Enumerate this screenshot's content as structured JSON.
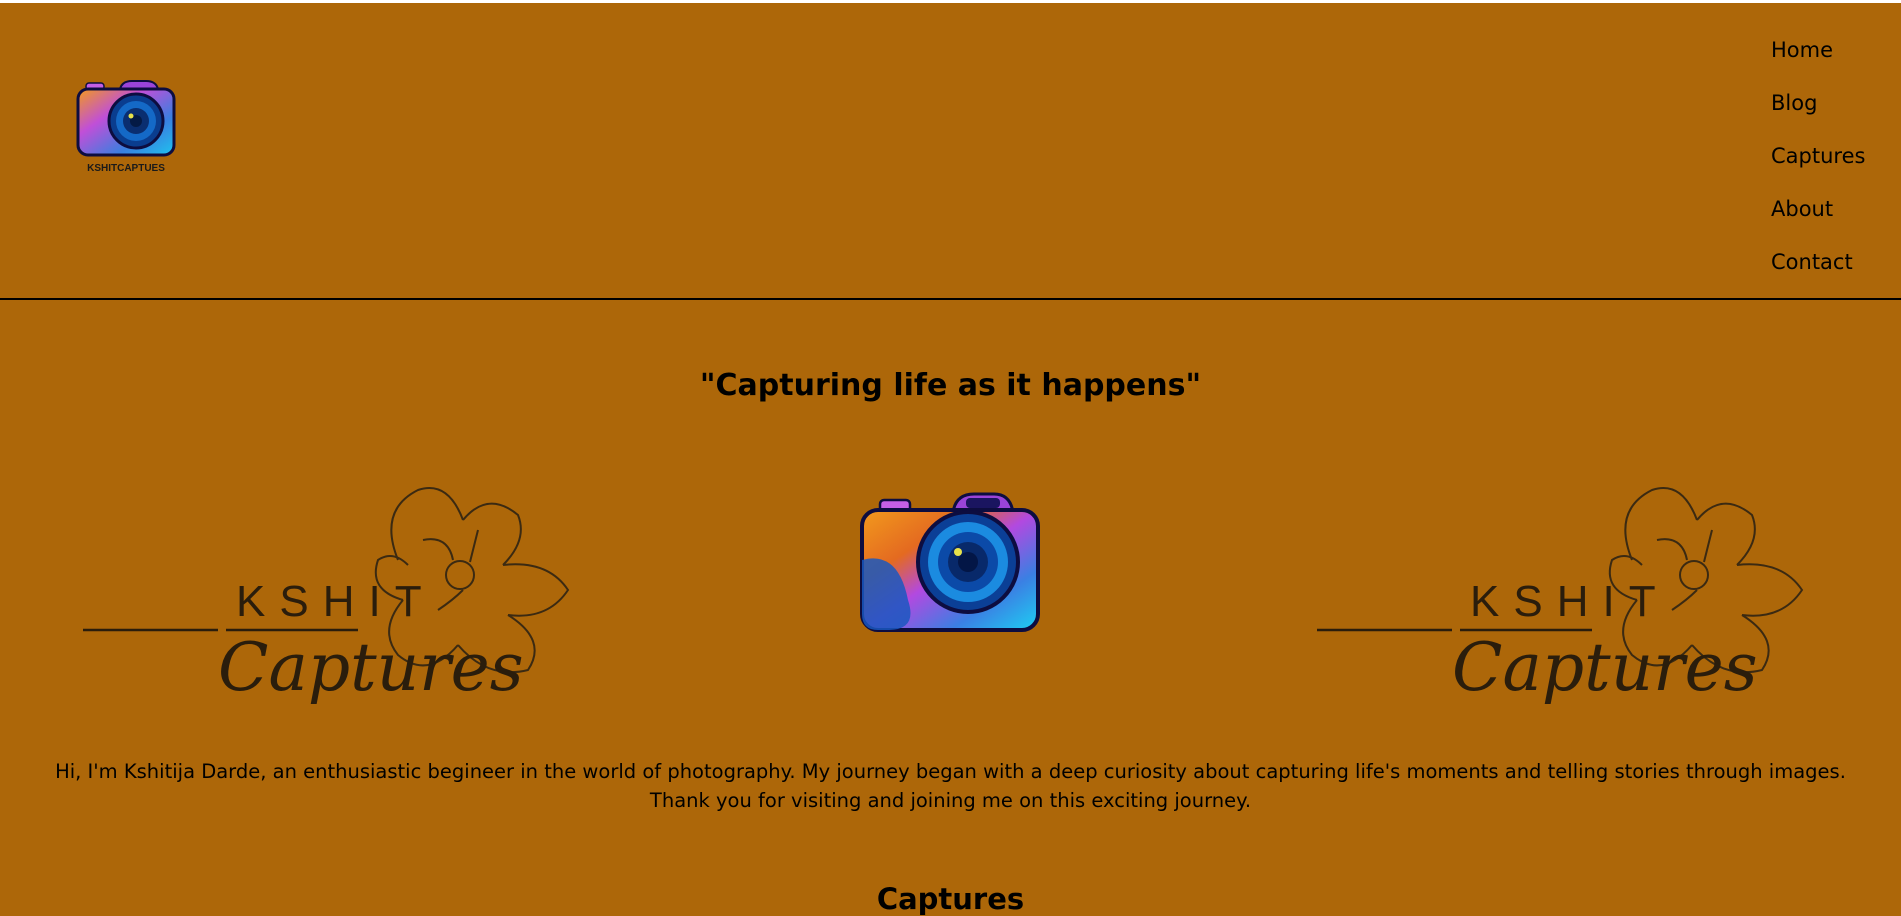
{
  "logo": {
    "caption": "KSHITCAPTUES",
    "icon": "camera-logo-icon"
  },
  "nav": {
    "items": [
      {
        "label": "Home"
      },
      {
        "label": "Blog"
      },
      {
        "label": "Captures"
      },
      {
        "label": "About"
      },
      {
        "label": "Contact"
      }
    ]
  },
  "hero": {
    "tagline": "\"Capturing life as it happens\"",
    "brand_logo": {
      "top": "KSHIT",
      "script": "Captures",
      "icon": "magnolia-flower-icon"
    },
    "camera_icon": "camera-icon"
  },
  "intro": {
    "text": "Hi, I'm Kshitija Darde, an enthusiastic begineer in the world of photography. My journey began with a deep curiosity about capturing life's moments and telling stories through images. Thank you for visiting and joining me on this exciting journey."
  },
  "sections": {
    "captures_title": "Captures"
  },
  "colors": {
    "background": "#ad6709",
    "text": "#000000",
    "divider": "#000000"
  }
}
